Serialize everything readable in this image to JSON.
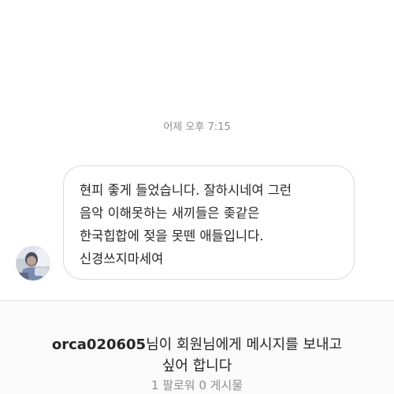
{
  "thread": {
    "timestamp": "어제 오후 7:15",
    "message": {
      "sender_avatar": "avatar-photo",
      "lines": [
        "현피 좋게 들었습니다. 잘하시네여 그런",
        "음악 이해못하는 새끼들은 좆같은",
        "한국힙합에 젖을 못뗀 애들입니다.",
        "신경쓰지마세여"
      ]
    }
  },
  "request": {
    "username": "orca020605",
    "text_line1_suffix": "님이 회원님에게 메시지를 보내고",
    "text_line2": "싶어 합니다",
    "stats": "1 팔로워 0 게시물"
  },
  "colors": {
    "bubble_border": "#dbdbdb",
    "muted_text": "#8e8e8e",
    "primary_text": "#262626",
    "panel_background": "#fafafa"
  }
}
